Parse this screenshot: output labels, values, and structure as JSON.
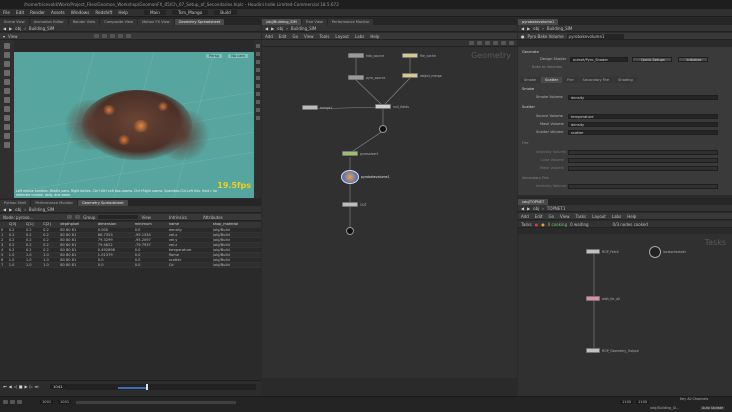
{
  "window": {
    "title": "/home/tricevold/Work/Project_Files/Gnomon_Workshop/GnomonFX_05/Ch_07_Setup_of_Secondaries.hiplc - Houdini Indie Limited-Commercial 18.5.672"
  },
  "menu": [
    "File",
    "Edit",
    "Render",
    "Assets",
    "Windows",
    "Redshift",
    "Help"
  ],
  "toolbar": {
    "shelf_set": "Main",
    "desktop": "Tsm_Mango",
    "build_label": "Build"
  },
  "left_tabs": [
    "Scene View",
    "Animation Editor",
    "Render View",
    "Composite View",
    "Motion FX View",
    "Geometry Spreadsheet"
  ],
  "viewport": {
    "path_label": "obj",
    "node_label": "Building_SIM",
    "view_label": "View",
    "camera_label": "Persp",
    "cam2_label": "No cam",
    "fps": "19.5fps",
    "info_text": "Left mouse tumbles. Middle pans. Right dollies. Ctrl+Alt+Left box-zooms. Ctrl+Right zooms. Spacebar-Ctrl-Left tilts. Hold L for alternate tumble, dolly, and zoom."
  },
  "lower_left_tabs": [
    "Python Shell",
    "Performance Monitor",
    "Geometry Spreadsheet"
  ],
  "spreadsheet": {
    "path_label": "obj",
    "node_label": "Building_SIM",
    "node_field": "Node: pyroso...",
    "group_label": "Group",
    "view_label": "View",
    "intrinsics_label": "Intrinsics",
    "attributes_label": "Attributes",
    "columns": [
      "",
      "C[0]",
      "C[1]",
      "C[2]",
      "depthpixel",
      "dimension",
      "minimum",
      "name",
      "shop_material"
    ],
    "rows": [
      [
        "0",
        "0.2",
        "0.2",
        "0.2",
        "80 80 81",
        "0.000",
        "0.0",
        "density",
        "/obj/Build"
      ],
      [
        "1",
        "0.2",
        "0.2",
        "0.2",
        "80 80 81",
        "86.7353",
        "-99.1334",
        "vel.x",
        "/obj/Build"
      ],
      [
        "2",
        "0.2",
        "0.2",
        "0.2",
        "80 80 81",
        "79.3299",
        "-95.2097",
        "vel.y",
        "/obj/Build"
      ],
      [
        "3",
        "0.2",
        "0.2",
        "0.2",
        "80 80 81",
        "79.4622",
        "-79.7937",
        "vel.z",
        "/obj/Build"
      ],
      [
        "4",
        "0.2",
        "0.2",
        "0.2",
        "80 80 81",
        "0.492898",
        "0.0",
        "temperature",
        "/obj/Build"
      ],
      [
        "5",
        "1.0",
        "1.0",
        "1.0",
        "80 80 81",
        "1.01379",
        "0.0",
        "flame",
        "/obj/Build"
      ],
      [
        "6",
        "1.0",
        "1.0",
        "1.0",
        "80 80 81",
        "0.0",
        "0.0",
        "scatter",
        "/obj/Build"
      ],
      [
        "7",
        "1.0",
        "1.0",
        "1.0",
        "80 80 81",
        "0.0",
        "0.0",
        "Cd",
        "/obj/Build"
      ]
    ]
  },
  "network_top_tabs": [
    "/obj/Building_SIM",
    "Tree View",
    "Performance Monitor"
  ],
  "network": {
    "path_label": "obj",
    "node_label": "Building_SIM",
    "menu": [
      "Add",
      "Edit",
      "Go",
      "View",
      "Tools",
      "Layout",
      "Labs",
      "Help"
    ],
    "context_label": "Geometry",
    "nodes": [
      {
        "label": "hda_source"
      },
      {
        "label": "file_cache"
      },
      {
        "label": "pyro_source"
      },
      {
        "label": "object_merge"
      },
      {
        "label": "merge1"
      },
      {
        "label": "null_fields"
      },
      {
        "label": "pyrosolver1"
      },
      {
        "label": "pyrobakevolume1"
      },
      {
        "label": "OUT"
      }
    ]
  },
  "params": {
    "tab_label": "pyrobakevolume1",
    "header_type": "Pyro Bake Volume",
    "header_name": "pyrobakevolume1",
    "section_label": "Generate",
    "design_label": "Design Shader",
    "design_value": "outset/Pyro_Shader",
    "quick_label": "Quick Setups",
    "initialize_label": "Initialize",
    "bake_label": "Bake to Volumes",
    "sub_tabs": [
      "Smoke",
      "Scatter",
      "Fire",
      "Secondary Fire",
      "Shading"
    ],
    "smoke_section": "Smoke",
    "smoke_volume_label": "Smoke Volume",
    "smoke_volume_value": "density",
    "scatter_section": "Scatter",
    "source_volume_label": "Source Volume",
    "source_volume_value": "temperature",
    "mask_volume_label": "Mask Volume",
    "mask_volume_value": "density",
    "scatter_volume_label": "Scatter Volume",
    "scatter_volume_value": "scatter",
    "fire_section": "Fire",
    "fire_l1": "Intensity Volume",
    "fire_l2": "Color Volume",
    "fire_l3": "Mask Volume",
    "fire2_section": "Secondary Fire",
    "fire2_l1": "Intensity Volume"
  },
  "tasks": {
    "tab_label": "/obj/TOPNET",
    "path_label": "obj",
    "node_label": "TOPNET1",
    "menu": [
      "Add",
      "Edit",
      "Go",
      "View",
      "Tasks",
      "Layout",
      "Labs",
      "Help"
    ],
    "tasks_label": "Tasks",
    "scheduled_label": "0 cooking",
    "waiting_label": "0 waiting",
    "nodes_cooked": "0/3 nodes cooked",
    "context_label": "Tasks",
    "nodes": [
      {
        "label": "ROP_Fetch"
      },
      {
        "label": "wait_for_all"
      },
      {
        "label": "localscheduler"
      },
      {
        "label": "ROP_Geometry_Output"
      }
    ]
  },
  "timeline": {
    "current_frame": "1041",
    "start_frame": "1001",
    "range_start": "1001",
    "range_end": "1100",
    "end_frame": "1100"
  },
  "status": {
    "auto_update": "Auto Update",
    "message": "Key All Channels",
    "node_path": "/obj/Building_SI..."
  }
}
